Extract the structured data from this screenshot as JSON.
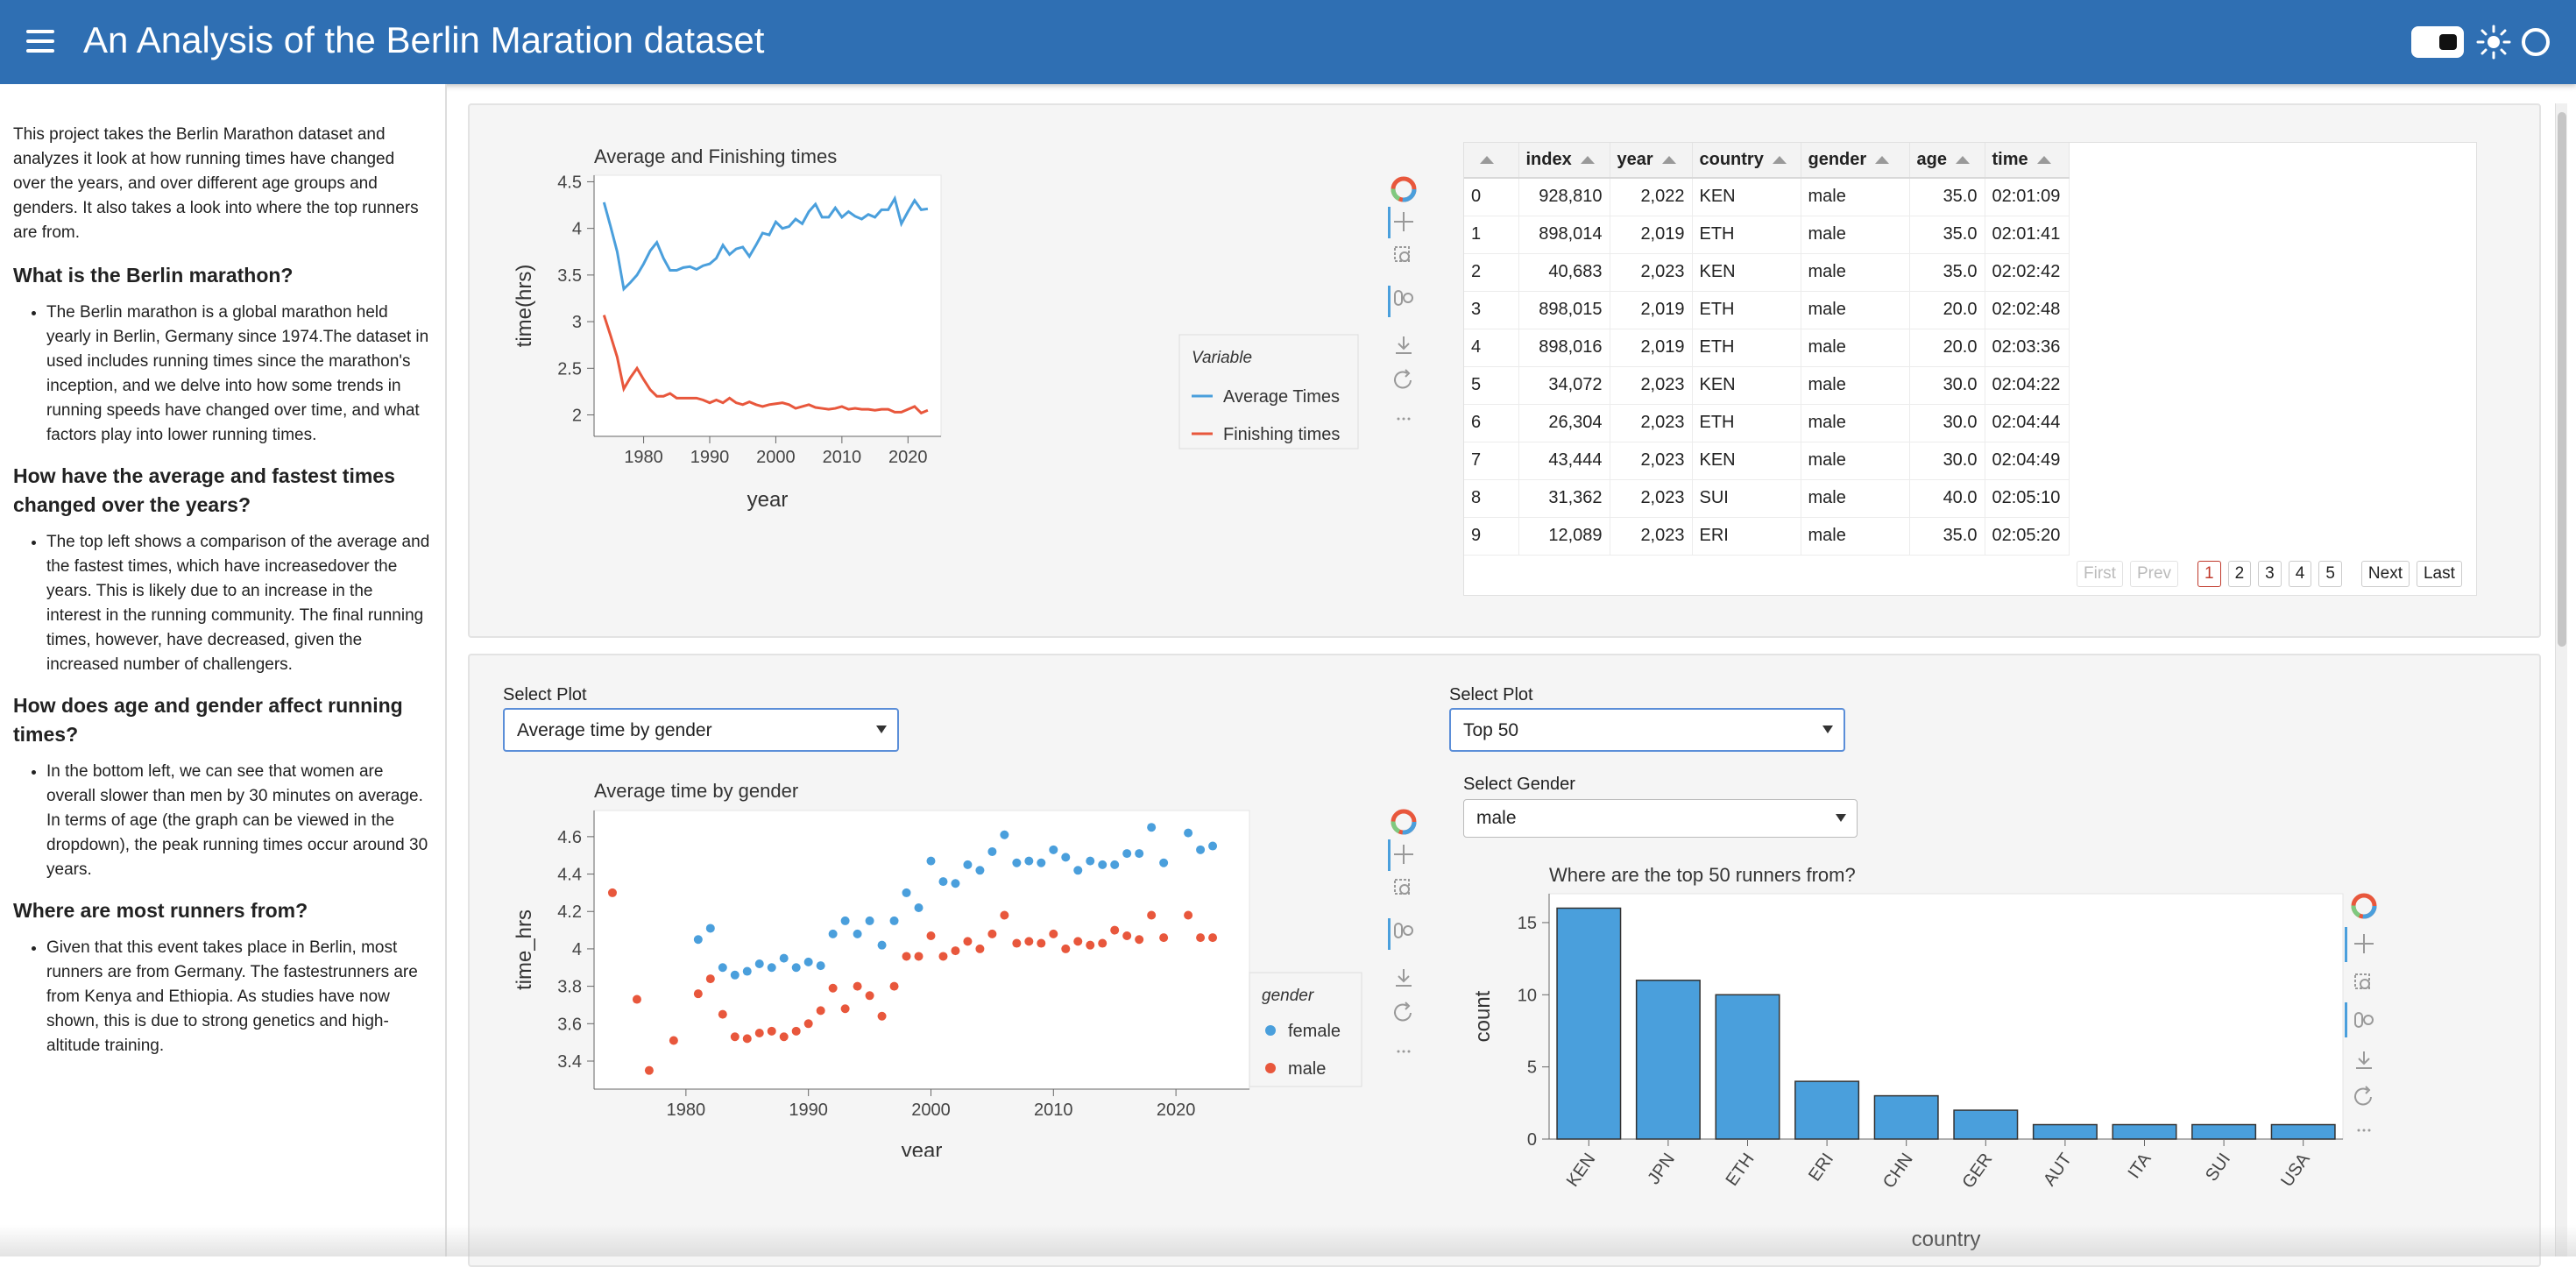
{
  "header": {
    "title": "An Analysis of the Berlin Maration dataset"
  },
  "sidebar": {
    "intro": "This project takes the Berlin Marathon dataset and analyzes it look at how running times have changed over the years, and over different age groups and genders. It also takes a look into where the top runners are from.",
    "sections": [
      {
        "heading": "What is the Berlin marathon?",
        "bullet": "The Berlin marathon is a global marathon held yearly in Berlin, Germany since 1974.The dataset in used includes running times since the marathon's inception, and we delve into how some trends in running speeds have changed over time, and what factors play into lower running times."
      },
      {
        "heading": "How have the average and fastest times changed over the years?",
        "bullet": "The top left shows a comparison of the average and the fastest times, which have increasedover the years. This is likely due to an increase in the interest in the running community. The final running times, however, have decreased, given the increased number of challengers."
      },
      {
        "heading": "How does age and gender affect running times?",
        "bullet": "In the bottom left, we can see that women are overall slower than men by 30 minutes on average. In terms of age (the graph can be viewed in the dropdown), the peak running times occur around 30 years."
      },
      {
        "heading": "Where are most runners from?",
        "bullet": "Given that this event takes place in Berlin, most runners are from Germany. The fastestrunners are from Kenya and Ethiopia. As studies have now shown, this is due to strong genetics and high-altitude training."
      }
    ]
  },
  "table": {
    "columns": [
      "",
      "index",
      "year",
      "country",
      "gender",
      "age",
      "time"
    ],
    "rows": [
      [
        "0",
        "928,810",
        "2,022",
        "KEN",
        "male",
        "35.0",
        "02:01:09"
      ],
      [
        "1",
        "898,014",
        "2,019",
        "ETH",
        "male",
        "35.0",
        "02:01:41"
      ],
      [
        "2",
        "40,683",
        "2,023",
        "KEN",
        "male",
        "35.0",
        "02:02:42"
      ],
      [
        "3",
        "898,015",
        "2,019",
        "ETH",
        "male",
        "20.0",
        "02:02:48"
      ],
      [
        "4",
        "898,016",
        "2,019",
        "ETH",
        "male",
        "20.0",
        "02:03:36"
      ],
      [
        "5",
        "34,072",
        "2,023",
        "KEN",
        "male",
        "30.0",
        "02:04:22"
      ],
      [
        "6",
        "26,304",
        "2,023",
        "ETH",
        "male",
        "30.0",
        "02:04:44"
      ],
      [
        "7",
        "43,444",
        "2,023",
        "KEN",
        "male",
        "30.0",
        "02:04:49"
      ],
      [
        "8",
        "31,362",
        "2,023",
        "SUI",
        "male",
        "40.0",
        "02:05:10"
      ],
      [
        "9",
        "12,089",
        "2,023",
        "ERI",
        "male",
        "35.0",
        "02:05:20"
      ]
    ],
    "pager": {
      "first": "First",
      "prev": "Prev",
      "pages": [
        "1",
        "2",
        "3",
        "4",
        "5"
      ],
      "current": "1",
      "next": "Next",
      "last": "Last"
    }
  },
  "controls": {
    "select_plot_label": "Select Plot",
    "left_select_value": "Average time by gender",
    "right_select_value": "Top 50",
    "select_gender_label": "Select Gender",
    "gender_value": "male"
  },
  "colors": {
    "blue": "#4a9fdc",
    "red": "#e8573c",
    "header": "#2f6fb3"
  },
  "chart_data": [
    {
      "type": "line",
      "title": "Average and Finishing times",
      "xlabel": "year",
      "ylabel": "time(hrs)",
      "xlim": [
        1972.5,
        2025
      ],
      "ylim": [
        1.77,
        4.57
      ],
      "xticks": [
        1980,
        1990,
        2000,
        2010,
        2020
      ],
      "yticks": [
        2,
        2.5,
        3,
        3.5,
        4,
        4.5
      ],
      "legend_title": "Variable",
      "legend_position": "right",
      "x": [
        1974,
        1975,
        1976,
        1977,
        1978,
        1979,
        1980,
        1981,
        1982,
        1983,
        1984,
        1985,
        1986,
        1987,
        1988,
        1989,
        1990,
        1991,
        1992,
        1993,
        1994,
        1995,
        1996,
        1997,
        1998,
        1999,
        2000,
        2001,
        2002,
        2003,
        2004,
        2005,
        2006,
        2007,
        2008,
        2009,
        2010,
        2011,
        2012,
        2013,
        2014,
        2015,
        2016,
        2017,
        2018,
        2019,
        2020,
        2021,
        2022,
        2023
      ],
      "series": [
        {
          "name": "Average Times",
          "color": "#4a9fdc",
          "values": [
            4.28,
            4.02,
            3.75,
            3.35,
            3.42,
            3.5,
            3.62,
            3.76,
            3.85,
            3.68,
            3.55,
            3.55,
            3.58,
            3.59,
            3.56,
            3.6,
            3.62,
            3.68,
            3.82,
            3.72,
            3.78,
            3.8,
            3.7,
            3.82,
            3.95,
            3.93,
            4.07,
            4.0,
            4.02,
            4.1,
            4.05,
            4.18,
            4.26,
            4.12,
            4.12,
            4.22,
            4.12,
            4.18,
            4.13,
            4.1,
            4.15,
            4.12,
            4.2,
            4.2,
            4.32,
            4.05,
            4.18,
            4.3,
            4.2,
            4.21
          ]
        },
        {
          "name": "Finishing times",
          "color": "#e8573c",
          "values": [
            3.07,
            2.85,
            2.62,
            2.28,
            2.4,
            2.5,
            2.38,
            2.27,
            2.2,
            2.2,
            2.23,
            2.18,
            2.18,
            2.18,
            2.18,
            2.16,
            2.13,
            2.16,
            2.13,
            2.18,
            2.13,
            2.11,
            2.14,
            2.11,
            2.09,
            2.11,
            2.12,
            2.13,
            2.11,
            2.07,
            2.09,
            2.11,
            2.08,
            2.07,
            2.06,
            2.07,
            2.09,
            2.06,
            2.07,
            2.06,
            2.06,
            2.05,
            2.06,
            2.06,
            2.03,
            2.03,
            2.06,
            2.09,
            2.02,
            2.05
          ]
        }
      ]
    },
    {
      "type": "scatter",
      "title": "Average time by gender",
      "xlabel": "year",
      "ylabel": "time_hrs",
      "xlim": [
        1972.5,
        2026
      ],
      "ylim": [
        3.25,
        4.74
      ],
      "xticks": [
        1980,
        1990,
        2000,
        2010,
        2020
      ],
      "yticks": [
        3.4,
        3.6,
        3.8,
        4,
        4.2,
        4.4,
        4.6
      ],
      "legend_title": "gender",
      "legend_position": "right",
      "series": [
        {
          "name": "female",
          "color": "#4a9fdc",
          "x": [
            1981,
            1982,
            1983,
            1984,
            1985,
            1986,
            1987,
            1988,
            1989,
            1990,
            1991,
            1992,
            1993,
            1994,
            1995,
            1996,
            1997,
            1998,
            1999,
            2000,
            2001,
            2002,
            2003,
            2004,
            2005,
            2006,
            2007,
            2008,
            2009,
            2010,
            2011,
            2012,
            2013,
            2014,
            2015,
            2016,
            2017,
            2018,
            2019,
            2021,
            2022,
            2023
          ],
          "y": [
            4.05,
            4.11,
            3.9,
            3.86,
            3.88,
            3.92,
            3.9,
            3.95,
            3.9,
            3.93,
            3.91,
            4.08,
            4.15,
            4.08,
            4.15,
            4.02,
            4.15,
            4.3,
            4.22,
            4.47,
            4.36,
            4.35,
            4.45,
            4.42,
            4.52,
            4.61,
            4.46,
            4.47,
            4.46,
            4.53,
            4.49,
            4.42,
            4.47,
            4.45,
            4.45,
            4.51,
            4.51,
            4.65,
            4.46,
            4.62,
            4.53,
            4.55
          ]
        },
        {
          "name": "male",
          "color": "#e8573c",
          "x": [
            1974,
            1976,
            1977,
            1979,
            1981,
            1982,
            1983,
            1984,
            1985,
            1986,
            1987,
            1988,
            1989,
            1990,
            1991,
            1992,
            1993,
            1994,
            1995,
            1996,
            1997,
            1998,
            1999,
            2000,
            2001,
            2002,
            2003,
            2004,
            2005,
            2006,
            2007,
            2008,
            2009,
            2010,
            2011,
            2012,
            2013,
            2014,
            2015,
            2016,
            2017,
            2018,
            2019,
            2021,
            2022,
            2023
          ],
          "y": [
            4.3,
            3.73,
            3.35,
            3.51,
            3.76,
            3.84,
            3.65,
            3.53,
            3.52,
            3.55,
            3.56,
            3.53,
            3.56,
            3.6,
            3.67,
            3.79,
            3.68,
            3.8,
            3.75,
            3.64,
            3.8,
            3.96,
            3.96,
            4.07,
            3.96,
            3.99,
            4.04,
            4.0,
            4.08,
            4.18,
            4.03,
            4.04,
            4.03,
            4.08,
            4.0,
            4.04,
            4.02,
            4.03,
            4.1,
            4.07,
            4.05,
            4.18,
            4.06,
            4.18,
            4.06,
            4.06
          ]
        }
      ]
    },
    {
      "type": "bar",
      "title": "Where are the top 50 runners from?",
      "xlabel": "country",
      "ylabel": "count",
      "ylim": [
        0,
        17
      ],
      "yticks": [
        0,
        5,
        10,
        15
      ],
      "categories": [
        "KEN",
        "JPN",
        "ETH",
        "ERI",
        "CHN",
        "GER",
        "AUT",
        "ITA",
        "SUI",
        "USA"
      ],
      "values": [
        16,
        11,
        10,
        4,
        3,
        2,
        1,
        1,
        1,
        1
      ],
      "color": "#4a9fdc"
    }
  ]
}
